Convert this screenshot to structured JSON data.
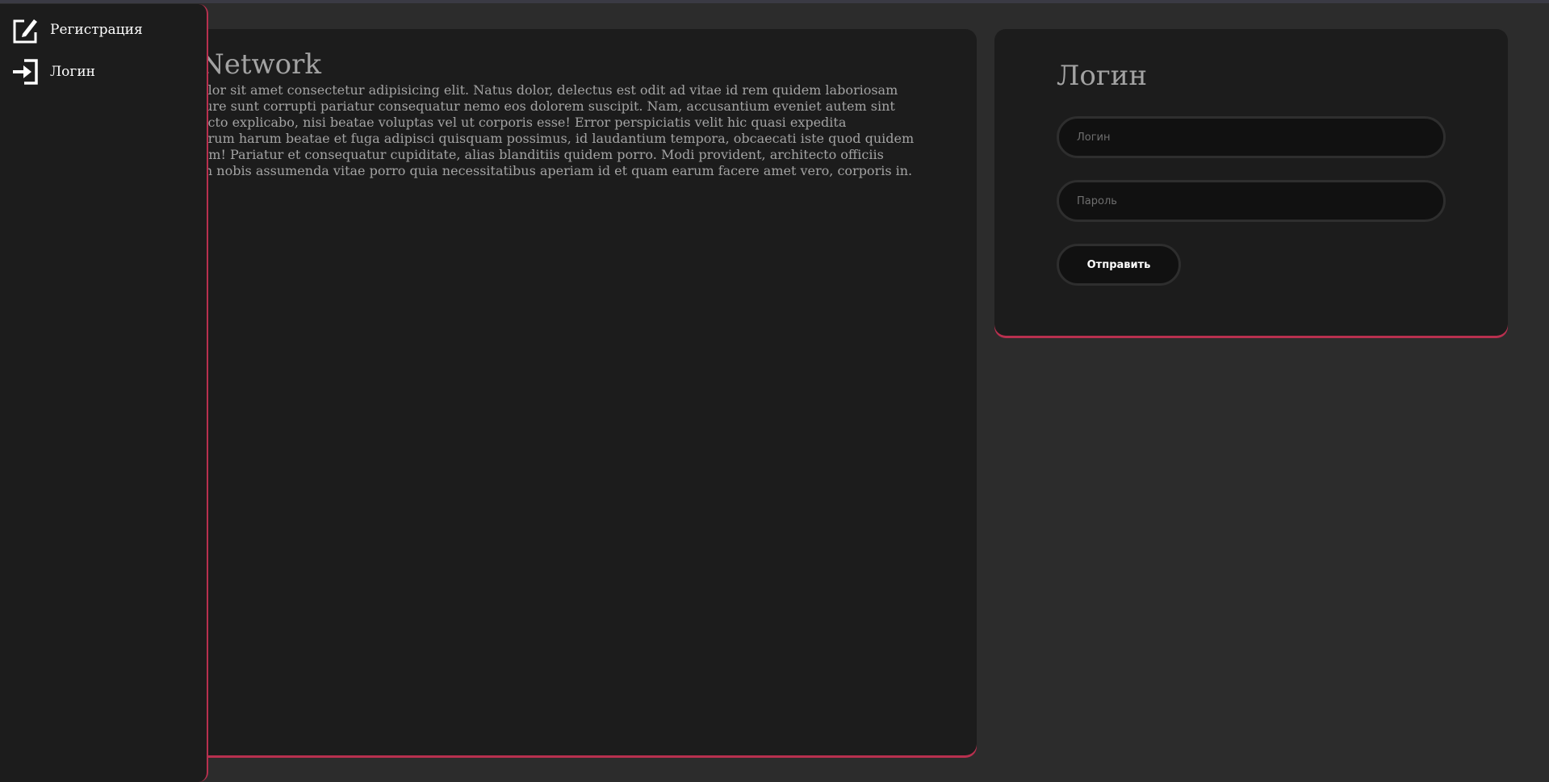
{
  "main": {
    "title": "Network",
    "text_lines": [
      "olor sit amet consectetur adipisicing elit. Natus dolor, delectus est odit ad vitae id rem quidem laboriosam",
      "iure sunt corrupti pariatur consequatur nemo eos dolorem suscipit. Nam, accusantium eveniet autem sint",
      "ecto explicabo, nisi beatae voluptas vel ut corporis esse! Error perspiciatis velit hic quasi expedita",
      "orum harum beatae et fuga adipisci quisquam possimus, id laudantium tempora, obcaecati iste quod quidem",
      "um! Pariatur et consequatur cupiditate, alias blanditiis quidem porro. Modi provident, architecto officiis",
      "m nobis assumenda vitae porro quia necessitatibus aperiam id et quam earum facere amet vero, corporis in."
    ]
  },
  "login": {
    "title": "Логин",
    "login_placeholder": "Логин",
    "password_placeholder": "Пароль",
    "submit_label": "Отправить"
  },
  "sidebar": {
    "items": [
      {
        "label": "Регистрация",
        "icon": "edit-icon"
      },
      {
        "label": "Логин",
        "icon": "login-icon"
      }
    ]
  },
  "colors": {
    "background": "#2c2c2c",
    "card": "#1c1c1c",
    "accent": "#b8304f",
    "text_muted": "#a3a3a3"
  }
}
